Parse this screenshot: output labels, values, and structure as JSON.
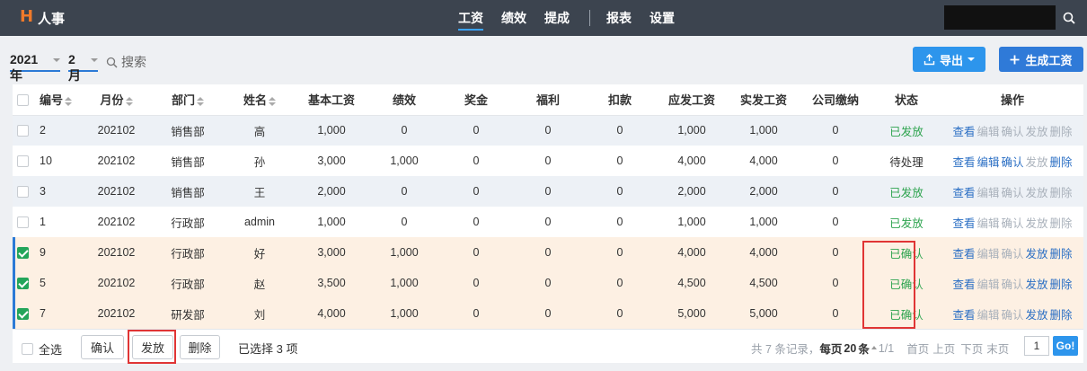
{
  "app": {
    "logo": "H",
    "title": "人事"
  },
  "nav": {
    "items": [
      {
        "label": "工资",
        "active": true
      },
      {
        "label": "绩效",
        "active": false
      },
      {
        "label": "提成",
        "active": false
      }
    ],
    "items_right": [
      {
        "label": "报表"
      },
      {
        "label": "设置"
      }
    ]
  },
  "filters": {
    "year": "2021年",
    "month": "2月",
    "search_label": "搜索"
  },
  "actions": {
    "export_label": "导出",
    "generate_label": "生成工资"
  },
  "table": {
    "columns": [
      "编号",
      "月份",
      "部门",
      "姓名",
      "基本工资",
      "绩效",
      "奖金",
      "福利",
      "扣款",
      "应发工资",
      "实发工资",
      "公司缴纳",
      "状态",
      "操作"
    ],
    "rows": [
      {
        "id": "2",
        "month": "202102",
        "dept": "销售部",
        "name": "高",
        "base": "1,000",
        "perf": "0",
        "bonus": "0",
        "welfare": "0",
        "deduct": "0",
        "gross": "1,000",
        "net": "1,000",
        "company": "0",
        "status": "已发放",
        "status_color": "#2ea44f",
        "checked": false,
        "row_style": "striped",
        "ops": [
          {
            "label": "查看",
            "enabled": true
          },
          {
            "label": "编辑",
            "enabled": false
          },
          {
            "label": "确认",
            "enabled": false
          },
          {
            "label": "发放",
            "enabled": false
          },
          {
            "label": "删除",
            "enabled": false
          }
        ]
      },
      {
        "id": "10",
        "month": "202102",
        "dept": "销售部",
        "name": "孙",
        "base": "3,000",
        "perf": "1,000",
        "bonus": "0",
        "welfare": "0",
        "deduct": "0",
        "gross": "4,000",
        "net": "4,000",
        "company": "0",
        "status": "待处理",
        "status_color": "#333333",
        "checked": false,
        "row_style": "plain",
        "ops": [
          {
            "label": "查看",
            "enabled": true
          },
          {
            "label": "编辑",
            "enabled": true
          },
          {
            "label": "确认",
            "enabled": true
          },
          {
            "label": "发放",
            "enabled": false
          },
          {
            "label": "删除",
            "enabled": true
          }
        ]
      },
      {
        "id": "3",
        "month": "202102",
        "dept": "销售部",
        "name": "王",
        "base": "2,000",
        "perf": "0",
        "bonus": "0",
        "welfare": "0",
        "deduct": "0",
        "gross": "2,000",
        "net": "2,000",
        "company": "0",
        "status": "已发放",
        "status_color": "#2ea44f",
        "checked": false,
        "row_style": "striped",
        "ops": [
          {
            "label": "查看",
            "enabled": true
          },
          {
            "label": "编辑",
            "enabled": false
          },
          {
            "label": "确认",
            "enabled": false
          },
          {
            "label": "发放",
            "enabled": false
          },
          {
            "label": "删除",
            "enabled": false
          }
        ]
      },
      {
        "id": "1",
        "month": "202102",
        "dept": "行政部",
        "name": "admin",
        "base": "1,000",
        "perf": "0",
        "bonus": "0",
        "welfare": "0",
        "deduct": "0",
        "gross": "1,000",
        "net": "1,000",
        "company": "0",
        "status": "已发放",
        "status_color": "#2ea44f",
        "checked": false,
        "row_style": "plain",
        "ops": [
          {
            "label": "查看",
            "enabled": true
          },
          {
            "label": "编辑",
            "enabled": false
          },
          {
            "label": "确认",
            "enabled": false
          },
          {
            "label": "发放",
            "enabled": false
          },
          {
            "label": "删除",
            "enabled": false
          }
        ]
      },
      {
        "id": "9",
        "month": "202102",
        "dept": "行政部",
        "name": "好",
        "base": "3,000",
        "perf": "1,000",
        "bonus": "0",
        "welfare": "0",
        "deduct": "0",
        "gross": "4,000",
        "net": "4,000",
        "company": "0",
        "status": "已确认",
        "status_color": "#2ea44f",
        "checked": true,
        "row_style": "selected",
        "ops": [
          {
            "label": "查看",
            "enabled": true
          },
          {
            "label": "编辑",
            "enabled": false
          },
          {
            "label": "确认",
            "enabled": false
          },
          {
            "label": "发放",
            "enabled": true
          },
          {
            "label": "删除",
            "enabled": true
          }
        ]
      },
      {
        "id": "5",
        "month": "202102",
        "dept": "行政部",
        "name": "赵",
        "base": "3,500",
        "perf": "1,000",
        "bonus": "0",
        "welfare": "0",
        "deduct": "0",
        "gross": "4,500",
        "net": "4,500",
        "company": "0",
        "status": "已确认",
        "status_color": "#2ea44f",
        "checked": true,
        "row_style": "selected",
        "ops": [
          {
            "label": "查看",
            "enabled": true
          },
          {
            "label": "编辑",
            "enabled": false
          },
          {
            "label": "确认",
            "enabled": false
          },
          {
            "label": "发放",
            "enabled": true
          },
          {
            "label": "删除",
            "enabled": true
          }
        ]
      },
      {
        "id": "7",
        "month": "202102",
        "dept": "研发部",
        "name": "刘",
        "base": "4,000",
        "perf": "1,000",
        "bonus": "0",
        "welfare": "0",
        "deduct": "0",
        "gross": "5,000",
        "net": "5,000",
        "company": "0",
        "status": "已确认",
        "status_color": "#2ea44f",
        "checked": true,
        "row_style": "selected",
        "ops": [
          {
            "label": "查看",
            "enabled": true
          },
          {
            "label": "编辑",
            "enabled": false
          },
          {
            "label": "确认",
            "enabled": false
          },
          {
            "label": "发放",
            "enabled": true
          },
          {
            "label": "删除",
            "enabled": true
          }
        ]
      }
    ]
  },
  "footer": {
    "select_all_label": "全选",
    "confirm_label": "确认",
    "issue_label": "发放",
    "delete_label": "删除",
    "selected_text": "已选择 3 项",
    "records_text": "共 7 条记录，",
    "per_page_prefix": "每页",
    "per_page_value": "20",
    "per_page_suffix": "条",
    "page_info": "1/1",
    "first_page": "首页",
    "prev_page": "上页",
    "next_page": "下页",
    "last_page": "末页",
    "page_input_value": "1",
    "go_label": "Go!"
  },
  "colors": {
    "topbar": "#3c444f",
    "accent": "#2d95ec",
    "status_green": "#2ea44f",
    "highlight": "#e03535",
    "selected_row": "#fdf0e3"
  }
}
